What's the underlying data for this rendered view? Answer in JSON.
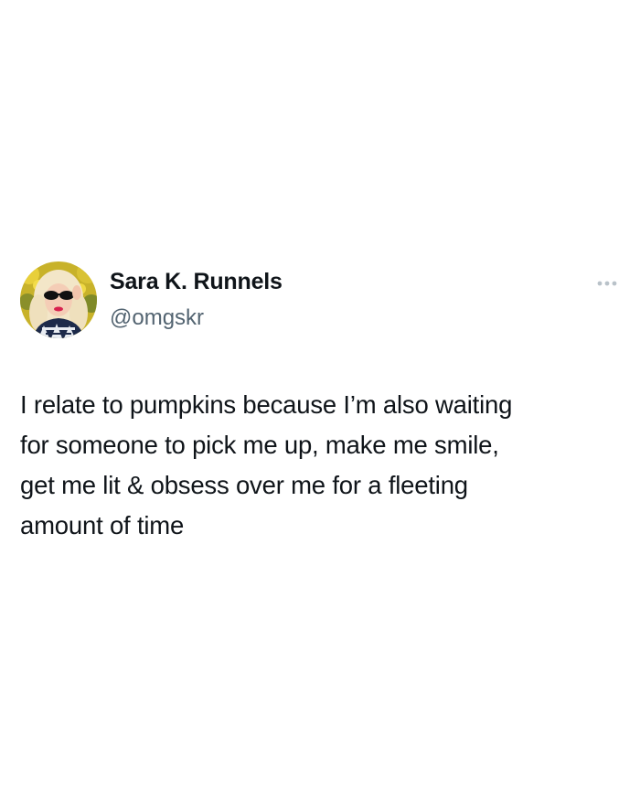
{
  "author": {
    "display_name": "Sara K. Runnels",
    "handle": "@omgskr",
    "avatar_icon": "profile-photo-icon"
  },
  "menu": {
    "icon": "more-options-icon"
  },
  "tweet": {
    "text_lines": [
      "I relate to pumpkins because I’m also waiting",
      "for someone to pick me up, make me smile,",
      "get me lit & obsess over me for a fleeting",
      "amount of time"
    ]
  },
  "colors": {
    "text": "#0f1419",
    "secondary_text": "#536471",
    "dots": "#b9c2c9",
    "background": "#ffffff"
  }
}
